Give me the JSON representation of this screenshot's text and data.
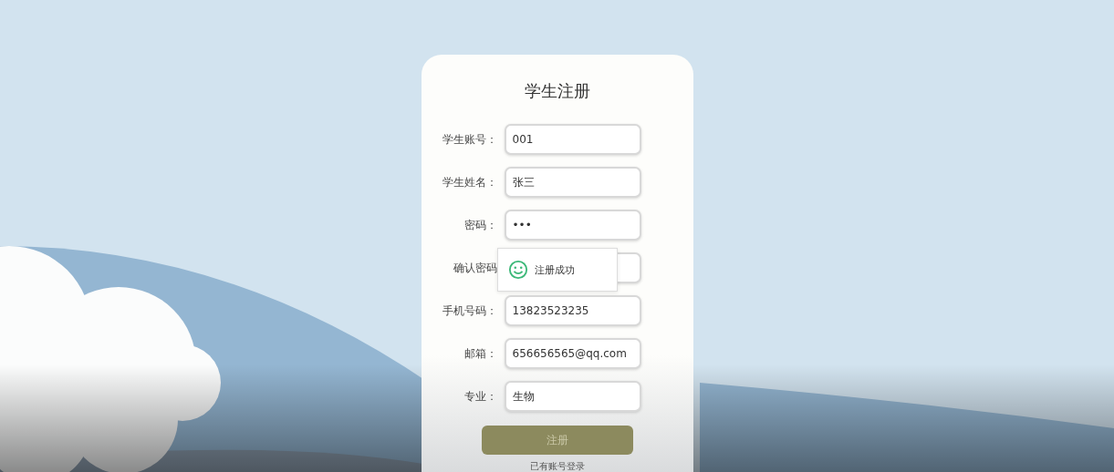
{
  "form": {
    "title": "学生注册",
    "fields": [
      {
        "label": "学生账号：",
        "value": "001"
      },
      {
        "label": "学生姓名：",
        "value": "张三"
      },
      {
        "label": "密码：",
        "value": "•••"
      },
      {
        "label": "确认密码"
      },
      {
        "label": "手机号码：",
        "value": "13823523235"
      },
      {
        "label": "邮箱：",
        "value": "656656565@qq.com"
      },
      {
        "label": "专业：",
        "value": "生物"
      }
    ],
    "submit_button": "注册",
    "login_link": "已有账号登录"
  },
  "toast": {
    "message": "注册成功"
  }
}
